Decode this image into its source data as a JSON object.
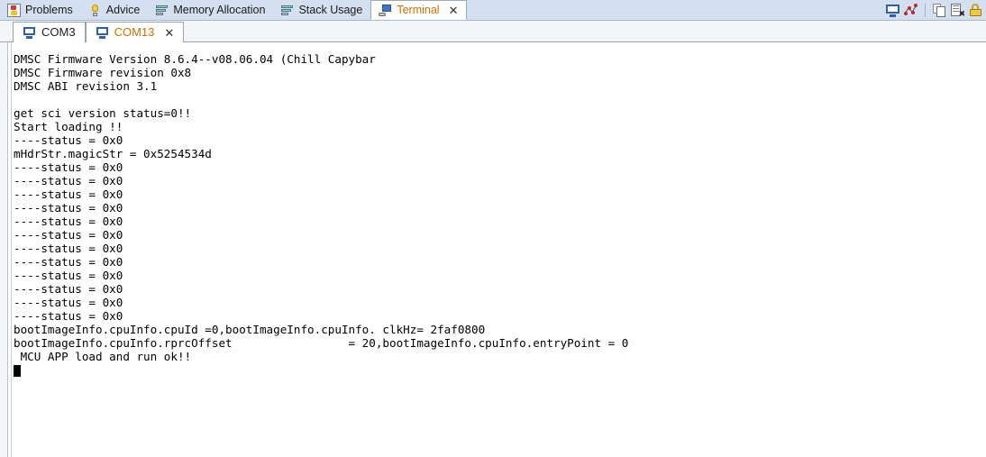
{
  "view_tabs": [
    {
      "label": "Problems",
      "icon": "problems-icon",
      "active": false,
      "closable": false
    },
    {
      "label": "Advice",
      "icon": "lightbulb-icon",
      "active": false,
      "closable": false
    },
    {
      "label": "Memory Allocation",
      "icon": "bar-chart-icon",
      "active": false,
      "closable": false
    },
    {
      "label": "Stack Usage",
      "icon": "bar-chart-icon",
      "active": false,
      "closable": false
    },
    {
      "label": "Terminal",
      "icon": "terminal-icon",
      "active": true,
      "closable": true
    }
  ],
  "toolbar": {
    "buttons": [
      {
        "name": "open-terminal-button",
        "icon": "display-icon",
        "title": "Open a Terminal"
      },
      {
        "name": "toggle-plot-button",
        "icon": "scatter-plot-icon",
        "title": "Plot"
      },
      {
        "name": "copy-button",
        "icon": "copy-icon",
        "title": "Copy"
      },
      {
        "name": "clear-terminal-button",
        "icon": "page-clear-icon",
        "title": "Clear Terminal"
      },
      {
        "name": "scroll-lock-button",
        "icon": "lock-icon",
        "title": "Scroll Lock"
      }
    ]
  },
  "connection_tabs": [
    {
      "label": "COM3",
      "icon": "monitor-icon",
      "active": false,
      "closable": false
    },
    {
      "label": "COM13",
      "icon": "monitor-icon",
      "active": true,
      "closable": true
    }
  ],
  "tab_close_glyph": "✕",
  "terminal": {
    "cursor_visible": true,
    "lines": [
      "DMSC Firmware Version 8.6.4--v08.06.04 (Chill Capybar",
      "DMSC Firmware revision 0x8",
      "DMSC ABI revision 3.1",
      "",
      "get sci version status=0!!",
      "Start loading !!",
      "----status = 0x0",
      "mHdrStr.magicStr = 0x5254534d",
      "----status = 0x0",
      "----status = 0x0",
      "----status = 0x0",
      "----status = 0x0",
      "----status = 0x0",
      "----status = 0x0",
      "----status = 0x0",
      "----status = 0x0",
      "----status = 0x0",
      "----status = 0x0",
      "----status = 0x0",
      "----status = 0x0",
      "bootImageInfo.cpuInfo.cpuId =0,bootImageInfo.cpuInfo. clkHz= 2faf0800",
      "bootImageInfo.cpuInfo.rprcOffset                 = 20,bootImageInfo.cpuInfo.entryPoint = 0",
      " MCU APP load and run ok!!"
    ]
  },
  "colors": {
    "tabbar_bg": "#d4dff0",
    "active_tab_text": "#d07000",
    "terminal_bg": "#ffffff",
    "terminal_text": "#000000"
  }
}
